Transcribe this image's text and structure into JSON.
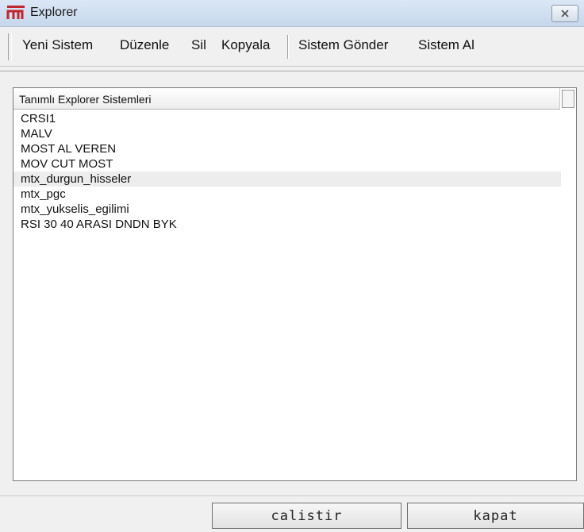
{
  "window": {
    "title": "Explorer",
    "app_icon": "m-logo-icon",
    "close_icon": "close-icon"
  },
  "menu": {
    "items": [
      {
        "id": "yeni-sistem",
        "label": "Yeni Sistem"
      },
      {
        "id": "duzenle",
        "label": "Düzenle"
      },
      {
        "id": "sil",
        "label": "Sil"
      },
      {
        "id": "kopyala",
        "label": "Kopyala"
      },
      {
        "id": "sistem-gonder",
        "label": "Sistem Gönder"
      },
      {
        "id": "sistem-al",
        "label": "Sistem Al"
      }
    ]
  },
  "list": {
    "header": "Tanımlı Explorer Sistemleri",
    "selected_index": 4,
    "items": [
      "CRSI1",
      "MALV",
      "MOST AL VEREN",
      "MOV CUT MOST",
      "mtx_durgun_hisseler",
      "mtx_pgc",
      "mtx_yukselis_egilimi",
      "RSI 30 40 ARASI DNDN BYK"
    ]
  },
  "buttons": {
    "run": "calistir",
    "close": "kapat"
  },
  "colors": {
    "titlebar": "#c6d7ec",
    "selected_row": "#ededed",
    "logo_red": "#c0262d"
  }
}
